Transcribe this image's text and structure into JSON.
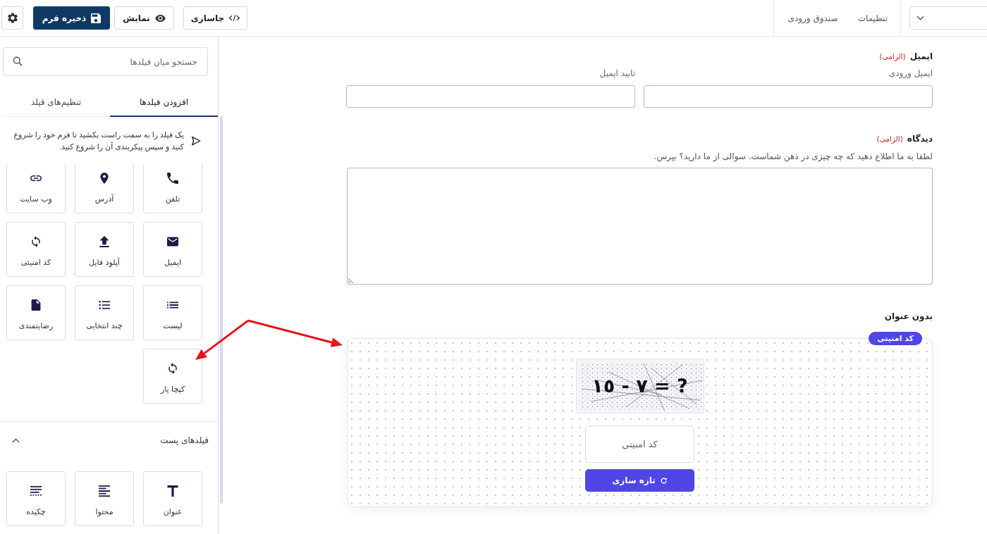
{
  "top_bar": {
    "nav": [
      {
        "label": "تنظیمات"
      },
      {
        "label": "صندوق ورودی"
      }
    ],
    "actions": [
      {
        "kind": "embed",
        "label": "جاسازی"
      },
      {
        "kind": "preview",
        "label": "نمایش"
      },
      {
        "kind": "save",
        "label": "ذخیره فرم"
      },
      {
        "kind": "settings"
      }
    ]
  },
  "form": {
    "fields": [
      {
        "kind": "email",
        "label": "ایمیل",
        "required_note": "(الزامی)",
        "inputs": [
          {
            "label": "ایمیل ورودی"
          },
          {
            "label": "تایید ایمیل"
          }
        ]
      },
      {
        "kind": "textarea",
        "label": "دیدگاه",
        "required_note": "(الزامی)",
        "description": "لطفا به ما اطلاع دهید که چه چیزی در ذهن شماست. سوالی از ما دارید؟ بپرس."
      },
      {
        "kind": "captcha",
        "label": "بدون عنوان",
        "badge": "کد امنیتی",
        "challenge": "١٥ - ٧ = ?",
        "placeholder": "کد امنیتی",
        "refresh_label": "تازه سازی"
      }
    ]
  },
  "sidebar": {
    "search": {
      "placeholder": "جستجو میان فیلدها"
    },
    "tabs": [
      {
        "label": "افزودن فیلدها",
        "selected": true
      },
      {
        "label": "تنظیم‌های فیلد",
        "selected": false
      }
    ],
    "hint": "یک فیلد را به سمت راست بکشید تا فرم خود را شروع کنید و سپس پیکربندی آن را شروع کنید.",
    "field_types": [
      {
        "kind": "phone",
        "label": "تلفن"
      },
      {
        "kind": "address",
        "label": "آدرس"
      },
      {
        "kind": "website",
        "label": "وب سایت"
      },
      {
        "kind": "email",
        "label": "ایمیل"
      },
      {
        "kind": "upload",
        "label": "آپلود فایل"
      },
      {
        "kind": "captcha",
        "label": "کد امنیتی"
      },
      {
        "kind": "list",
        "label": "لیست"
      },
      {
        "kind": "multiselect",
        "label": "چند انتخابی"
      },
      {
        "kind": "rating",
        "label": "رضایتمندی"
      },
      {
        "kind": "captcha",
        "label": "کپچا یار"
      }
    ],
    "post_fields": {
      "title": "فیلدهای پست",
      "expanded": true,
      "items": [
        {
          "kind": "title",
          "label": "عنوان"
        },
        {
          "kind": "content",
          "label": "محتوا"
        },
        {
          "kind": "excerpt",
          "label": "چکیده"
        }
      ]
    }
  }
}
